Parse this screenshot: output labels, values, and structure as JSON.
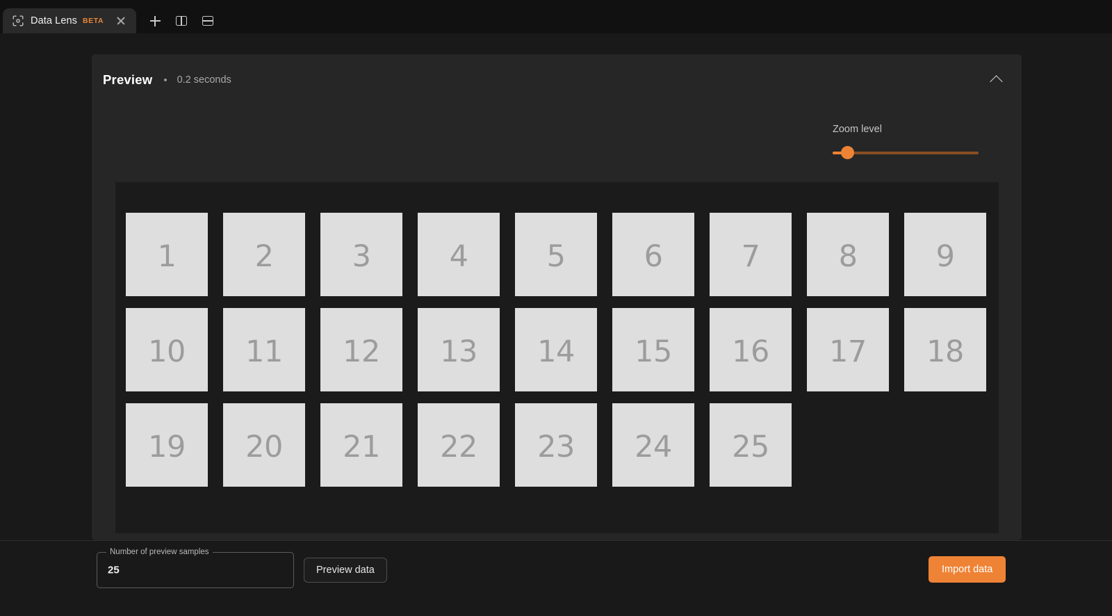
{
  "window": {
    "tab": {
      "icon": "scan-target-icon",
      "title": "Data Lens",
      "badge": "BETA",
      "close_icon": "close-icon"
    },
    "actions": {
      "new_tab_icon": "plus-icon",
      "split_vertical_icon": "split-vertical-icon",
      "split_horizontal_icon": "split-horizontal-icon"
    }
  },
  "card": {
    "title": "Preview",
    "separator": "•",
    "subtitle": "0.2 seconds",
    "collapse_icon": "chevron-up-icon"
  },
  "zoom": {
    "label": "Zoom level",
    "value": 10,
    "min": 0,
    "max": 100,
    "track_color": "#8a4f24",
    "accent_color": "#ef8335"
  },
  "preview": {
    "tiles": [
      "1",
      "2",
      "3",
      "4",
      "5",
      "6",
      "7",
      "8",
      "9",
      "10",
      "11",
      "12",
      "13",
      "14",
      "15",
      "16",
      "17",
      "18",
      "19",
      "20",
      "21",
      "22",
      "23",
      "24",
      "25"
    ],
    "tile_fill": "#dedede",
    "tile_text_color": "#9c9c9c",
    "columns": 9,
    "surface_color": "#1b1b1b"
  },
  "footer": {
    "samples_field": {
      "label": "Number of preview samples",
      "value": "25",
      "placeholder": "25"
    },
    "preview_button": "Preview data",
    "import_button": "Import data"
  }
}
